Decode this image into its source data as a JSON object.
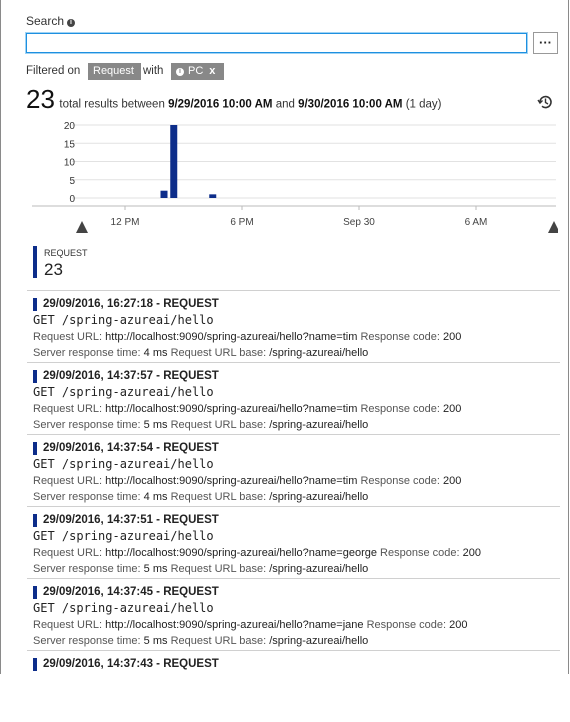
{
  "search": {
    "label": "Search",
    "value": "",
    "more_label": "···"
  },
  "filter": {
    "prefix": "Filtered on",
    "type_chip": "Request",
    "with": "with",
    "pc_chip": "PC",
    "pc_close": "x"
  },
  "total": {
    "count": "23",
    "text_a": "total results between",
    "start": "9/29/2016 10:00 AM",
    "and": "and",
    "end": "9/30/2016 10:00 AM",
    "duration": "(1 day)"
  },
  "chart_data": {
    "type": "bar",
    "x_ticks": [
      "12 PM",
      "6 PM",
      "Sep 30",
      "6 AM"
    ],
    "y_ticks": [
      20,
      15,
      10,
      5,
      0
    ],
    "ylim": [
      0,
      20
    ],
    "bars": [
      {
        "x": "29/09/2016 14:00",
        "value": 2
      },
      {
        "x": "29/09/2016 14:30",
        "value": 20
      },
      {
        "x": "29/09/2016 16:30",
        "value": 1
      }
    ],
    "color": "#0d2d8a",
    "xlabel": "",
    "ylabel": ""
  },
  "summary": {
    "label": "REQUEST",
    "count": "23"
  },
  "labels": {
    "url": "Request URL:",
    "code": "Response code:",
    "time": "Server response time:",
    "base": "Request URL base:"
  },
  "results": [
    {
      "title": "29/09/2016, 16:27:18 - REQUEST",
      "cmd": "GET /spring-azureai/hello",
      "url": "http://localhost:9090/spring-azureai/hello?name=tim",
      "code": "200",
      "time": "4 ms",
      "base": "/spring-azureai/hello"
    },
    {
      "title": "29/09/2016, 14:37:57 - REQUEST",
      "cmd": "GET /spring-azureai/hello",
      "url": "http://localhost:9090/spring-azureai/hello?name=tim",
      "code": "200",
      "time": "5 ms",
      "base": "/spring-azureai/hello"
    },
    {
      "title": "29/09/2016, 14:37:54 - REQUEST",
      "cmd": "GET /spring-azureai/hello",
      "url": "http://localhost:9090/spring-azureai/hello?name=tim",
      "code": "200",
      "time": "4 ms",
      "base": "/spring-azureai/hello"
    },
    {
      "title": "29/09/2016, 14:37:51 - REQUEST",
      "cmd": "GET /spring-azureai/hello",
      "url": "http://localhost:9090/spring-azureai/hello?name=george",
      "code": "200",
      "time": "5 ms",
      "base": "/spring-azureai/hello"
    },
    {
      "title": "29/09/2016, 14:37:45 - REQUEST",
      "cmd": "GET /spring-azureai/hello",
      "url": "http://localhost:9090/spring-azureai/hello?name=jane",
      "code": "200",
      "time": "5 ms",
      "base": "/spring-azureai/hello"
    },
    {
      "title": "29/09/2016, 14:37:43 - REQUEST",
      "cmd": "",
      "url": "",
      "code": "",
      "time": "",
      "base": ""
    }
  ]
}
